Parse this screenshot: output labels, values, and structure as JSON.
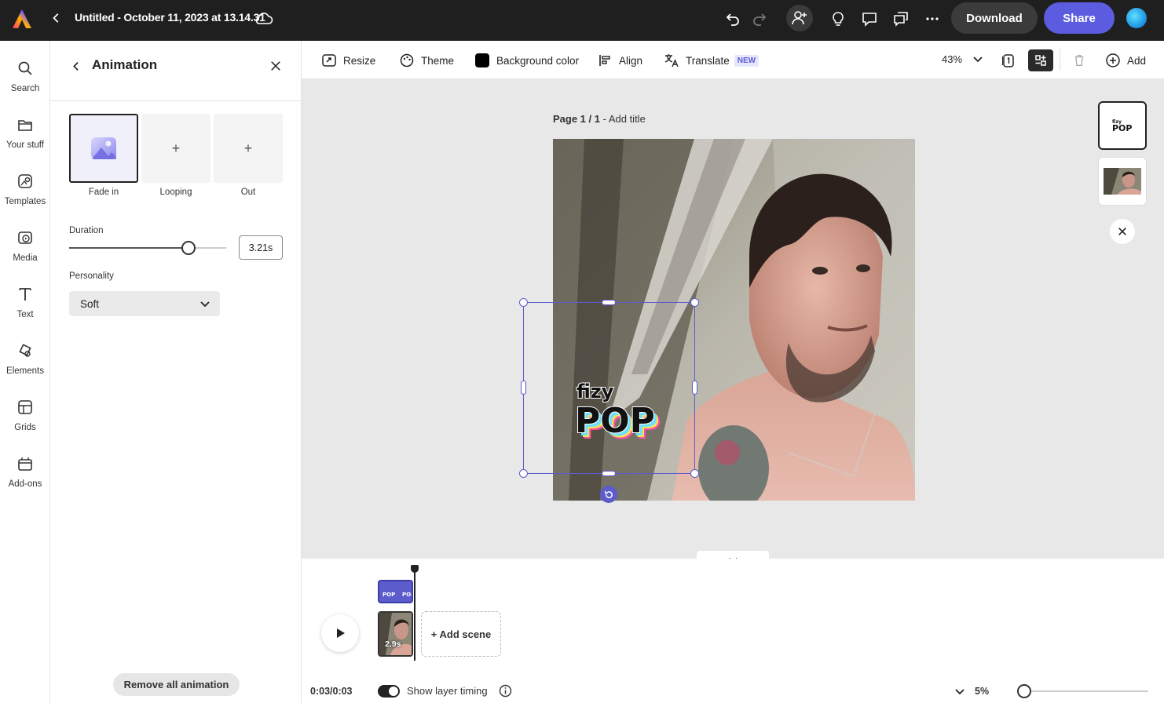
{
  "topbar": {
    "title": "Untitled - October 11, 2023 at 13.14.31",
    "download_label": "Download",
    "share_label": "Share",
    "icons": [
      "adobe-express-logo",
      "back-chevron",
      "cloud-sync",
      "undo",
      "redo",
      "invite-user",
      "lightbulb",
      "comment",
      "present",
      "more"
    ]
  },
  "rail": {
    "items": [
      {
        "label": "Search",
        "icon": "search-icon"
      },
      {
        "label": "Your stuff",
        "icon": "folder-icon"
      },
      {
        "label": "Templates",
        "icon": "templates-icon"
      },
      {
        "label": "Media",
        "icon": "media-icon"
      },
      {
        "label": "Text",
        "icon": "text-icon"
      },
      {
        "label": "Elements",
        "icon": "elements-icon"
      },
      {
        "label": "Grids",
        "icon": "grids-icon"
      },
      {
        "label": "Add-ons",
        "icon": "addons-icon"
      }
    ]
  },
  "panel": {
    "title": "Animation",
    "tiles": [
      {
        "label": "Fade in",
        "selected": true
      },
      {
        "label": "Looping",
        "symbol": "+"
      },
      {
        "label": "Out",
        "symbol": "+"
      }
    ],
    "duration_label": "Duration",
    "duration_value": "3.21s",
    "duration_fraction": 0.76,
    "personality_label": "Personality",
    "personality_value": "Soft",
    "remove_label": "Remove all animation"
  },
  "toolbar": {
    "resize": "Resize",
    "theme": "Theme",
    "background_color": "Background color",
    "align": "Align",
    "translate": "Translate",
    "translate_badge": "NEW",
    "zoom": "43%",
    "add": "Add"
  },
  "canvas": {
    "page_label_bold": "Page 1 / 1",
    "page_label_rest": " - Add title",
    "sticker_top": "fizy",
    "sticker_main": "POP"
  },
  "timeline": {
    "clip_duration": "2.9s",
    "add_scene": "+ Add scene",
    "time": "0:03/0:03",
    "show_layer_timing": "Show layer timing",
    "show_layer_timing_on": true,
    "zoom": "5%"
  },
  "colors": {
    "accent": "#5c5ce0",
    "selection": "#5c5ccc",
    "topbar": "#1f1f1f"
  }
}
